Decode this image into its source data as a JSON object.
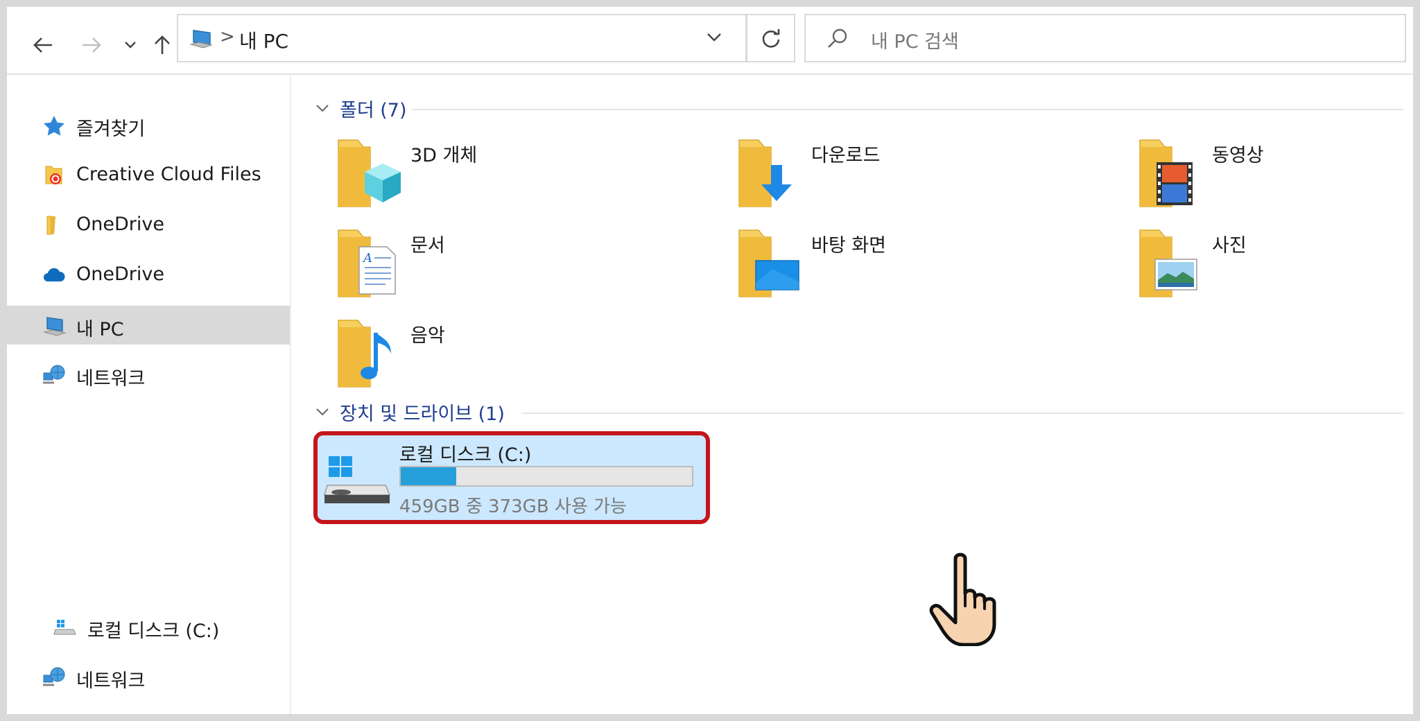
{
  "toolbar": {
    "back_icon": "arrow-left-icon",
    "forward_icon": "arrow-right-icon",
    "recent_icon": "chevron-down-icon",
    "up_icon": "arrow-up-icon",
    "address": {
      "separator": ">",
      "crumb": "내 PC"
    },
    "refresh_icon": "refresh-icon",
    "search": {
      "placeholder": "내 PC 검색"
    }
  },
  "sidebar": {
    "items": [
      {
        "label": "즐겨찾기",
        "icon": "star-icon"
      },
      {
        "label": "Creative Cloud Files",
        "icon": "creative-cloud-folder-icon"
      },
      {
        "label": "OneDrive",
        "icon": "folder-icon"
      },
      {
        "label": "OneDrive",
        "icon": "cloud-icon"
      },
      {
        "label": "내 PC",
        "icon": "computer-icon",
        "selected": true
      },
      {
        "label": "네트워크",
        "icon": "network-icon"
      },
      {
        "label": "로컬 디스크 (C:)",
        "icon": "drive-icon"
      },
      {
        "label": "네트워크",
        "icon": "network-icon"
      }
    ]
  },
  "content": {
    "folders_header": "폴더 (7)",
    "folders": [
      {
        "label": "3D 개체",
        "icon": "3d-objects-folder-icon"
      },
      {
        "label": "다운로드",
        "icon": "downloads-folder-icon"
      },
      {
        "label": "동영상",
        "icon": "videos-folder-icon"
      },
      {
        "label": "문서",
        "icon": "documents-folder-icon"
      },
      {
        "label": "바탕 화면",
        "icon": "desktop-folder-icon"
      },
      {
        "label": "사진",
        "icon": "pictures-folder-icon"
      },
      {
        "label": "음악",
        "icon": "music-folder-icon"
      }
    ],
    "devices_header": "장치 및 드라이브 (1)",
    "drive": {
      "label": "로컬 디스크 (C:)",
      "space": "459GB 중 373GB 사용 가능",
      "used_fraction": 0.19,
      "icon": "hard-drive-icon"
    }
  },
  "overlay": {
    "cursor_icon": "hand-pointer-icon",
    "highlight_color": "#c4161c"
  },
  "colors": {
    "selection": "#cce8ff",
    "group_header": "#1e3d8f",
    "progress": "#26a0da"
  }
}
